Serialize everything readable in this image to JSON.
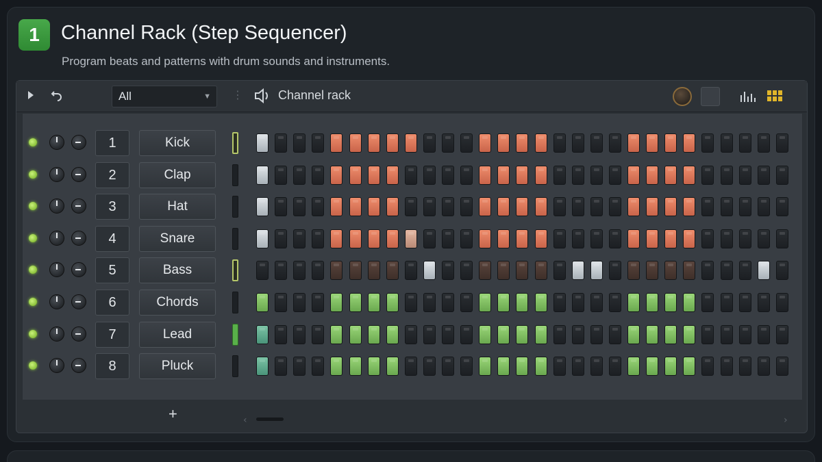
{
  "header": {
    "badge": "1",
    "title": "Channel Rack (Step Sequencer)",
    "subtitle": "Program beats and patterns with drum sounds and instruments."
  },
  "toolbar": {
    "filter_value": "All",
    "rack_label": "Channel rack",
    "icons": [
      "play-arrow-icon",
      "undo-icon",
      "chevron-down-icon",
      "more-dots-icon",
      "speaker-icon",
      "swing-knob-icon",
      "graph-editor-icon",
      "step-view-icon"
    ]
  },
  "colors": {
    "led": "#8fd13a",
    "badge": "#3e9a41",
    "step_off": "#24282c",
    "step_white": "#c2c9cf",
    "step_orange": "#e07a5a",
    "step_peach": "#d6a48e",
    "step_brown": "#4e3a33",
    "step_green": "#86c466",
    "step_teal": "#5fae8e",
    "accent_yellow": "#e0b52a"
  },
  "channels": [
    {
      "number": "1",
      "name": "Kick",
      "selector": "outline",
      "steps": [
        "W",
        "o",
        "o",
        "o",
        "R",
        "R",
        "R",
        "R",
        "R",
        "o",
        "o",
        "o",
        "R",
        "R",
        "R",
        "R",
        "o",
        "o",
        "o",
        "o",
        "R",
        "R",
        "R",
        "R",
        "o",
        "o",
        "o",
        "o",
        "o"
      ]
    },
    {
      "number": "2",
      "name": "Clap",
      "selector": "off",
      "steps": [
        "W",
        "o",
        "o",
        "o",
        "R",
        "R",
        "R",
        "R",
        "o",
        "o",
        "o",
        "o",
        "R",
        "R",
        "R",
        "R",
        "o",
        "o",
        "o",
        "o",
        "R",
        "R",
        "R",
        "R",
        "o",
        "o",
        "o",
        "o",
        "o"
      ]
    },
    {
      "number": "3",
      "name": "Hat",
      "selector": "off",
      "steps": [
        "W",
        "o",
        "o",
        "o",
        "R",
        "R",
        "R",
        "R",
        "o",
        "o",
        "o",
        "o",
        "R",
        "R",
        "R",
        "R",
        "o",
        "o",
        "o",
        "o",
        "R",
        "R",
        "R",
        "R",
        "o",
        "o",
        "o",
        "o",
        "o"
      ]
    },
    {
      "number": "4",
      "name": "Snare",
      "selector": "off",
      "steps": [
        "W",
        "o",
        "o",
        "o",
        "R",
        "R",
        "R",
        "R",
        "P",
        "o",
        "o",
        "o",
        "R",
        "R",
        "R",
        "R",
        "o",
        "o",
        "o",
        "o",
        "R",
        "R",
        "R",
        "R",
        "o",
        "o",
        "o",
        "o",
        "o"
      ]
    },
    {
      "number": "5",
      "name": "Bass",
      "selector": "outline",
      "steps": [
        "o",
        "o",
        "o",
        "o",
        "B",
        "B",
        "B",
        "B",
        "o",
        "W",
        "o",
        "o",
        "B",
        "B",
        "B",
        "B",
        "o",
        "W",
        "W",
        "o",
        "B",
        "B",
        "B",
        "B",
        "o",
        "o",
        "o",
        "W",
        "o"
      ]
    },
    {
      "number": "6",
      "name": "Chords",
      "selector": "off",
      "steps": [
        "G",
        "o",
        "o",
        "o",
        "G",
        "G",
        "G",
        "G",
        "o",
        "o",
        "o",
        "o",
        "G",
        "G",
        "G",
        "G",
        "o",
        "o",
        "o",
        "o",
        "G",
        "G",
        "G",
        "G",
        "o",
        "o",
        "o",
        "o",
        "o"
      ]
    },
    {
      "number": "7",
      "name": "Lead",
      "selector": "fill",
      "steps": [
        "T",
        "o",
        "o",
        "o",
        "G",
        "G",
        "G",
        "G",
        "o",
        "o",
        "o",
        "o",
        "G",
        "G",
        "G",
        "G",
        "o",
        "o",
        "o",
        "o",
        "G",
        "G",
        "G",
        "G",
        "o",
        "o",
        "o",
        "o",
        "o"
      ]
    },
    {
      "number": "8",
      "name": "Pluck",
      "selector": "off",
      "steps": [
        "T",
        "o",
        "o",
        "o",
        "G",
        "G",
        "G",
        "G",
        "o",
        "o",
        "o",
        "o",
        "G",
        "G",
        "G",
        "G",
        "o",
        "o",
        "o",
        "o",
        "G",
        "G",
        "G",
        "G",
        "o",
        "o",
        "o",
        "o",
        "o"
      ]
    }
  ],
  "footer": {
    "add_label": "+"
  }
}
